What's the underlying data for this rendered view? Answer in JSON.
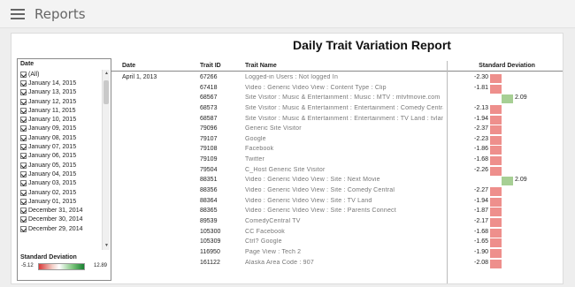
{
  "app": {
    "title": "Reports"
  },
  "report": {
    "title": "Daily Trait Variation Report",
    "filter": {
      "title": "Date",
      "items": [
        "(All)",
        "January 14, 2015",
        "January 13, 2015",
        "January 12, 2015",
        "January 11, 2015",
        "January 10, 2015",
        "January 09, 2015",
        "January 08, 2015",
        "January 07, 2015",
        "January 06, 2015",
        "January 05, 2015",
        "January 04, 2015",
        "January 03, 2015",
        "January 02, 2015",
        "January 01, 2015",
        "December 31, 2014",
        "December 30, 2014",
        "December 29, 2014"
      ]
    },
    "legend": {
      "title": "Standard Deviation",
      "min": "-5.12",
      "max": "12.89",
      "colors": {
        "negative": "#d93a3a",
        "neutral": "#ffffff",
        "positive": "#17802f"
      }
    },
    "columns": {
      "date": "Date",
      "trait_id": "Trait ID",
      "trait_name": "Trait Name",
      "standard_deviation": "Standard Deviation"
    },
    "rows": [
      {
        "date": "April 1, 2013",
        "trait_id": "67266",
        "trait_name": "Logged-in Users : Not logged In",
        "value": "-2.30",
        "sign": "negative"
      },
      {
        "date": "",
        "trait_id": "67418",
        "trait_name": "Video : Generic Video View : Content Type : Clip",
        "value": "-1.81",
        "sign": "negative"
      },
      {
        "date": "",
        "trait_id": "68567",
        "trait_name": "Site Visitor : Music & Entertainment : Music : MTV : mtvfmovie.com",
        "value": "2.09",
        "sign": "positive"
      },
      {
        "date": "",
        "trait_id": "68573",
        "trait_name": "Site Visitor : Music & Entertainment : Entertainment : Comedy Central : c...",
        "value": "-2.13",
        "sign": "negative"
      },
      {
        "date": "",
        "trait_id": "68587",
        "trait_name": "Site Visitor : Music & Entertainment : Entertainment : TV Land : tvland.com",
        "value": "-1.94",
        "sign": "negative"
      },
      {
        "date": "",
        "trait_id": "79096",
        "trait_name": "Generic Site Visitor",
        "value": "-2.37",
        "sign": "negative"
      },
      {
        "date": "",
        "trait_id": "79107",
        "trait_name": "Google",
        "value": "-2.23",
        "sign": "negative"
      },
      {
        "date": "",
        "trait_id": "79108",
        "trait_name": "Facebook",
        "value": "-1.86",
        "sign": "negative"
      },
      {
        "date": "",
        "trait_id": "79109",
        "trait_name": "Twitter",
        "value": "-1.68",
        "sign": "negative"
      },
      {
        "date": "",
        "trait_id": "79504",
        "trait_name": "C_Host Generic Site Visitor",
        "value": "-2.26",
        "sign": "negative"
      },
      {
        "date": "",
        "trait_id": "88351",
        "trait_name": "Video : Generic Video View : Site : Next Movie",
        "value": "2.09",
        "sign": "positive"
      },
      {
        "date": "",
        "trait_id": "88356",
        "trait_name": "Video : Generic Video View : Site : Comedy Central",
        "value": "-2.27",
        "sign": "negative"
      },
      {
        "date": "",
        "trait_id": "88364",
        "trait_name": "Video : Generic Video View : Site : TV Land",
        "value": "-1.94",
        "sign": "negative"
      },
      {
        "date": "",
        "trait_id": "88365",
        "trait_name": "Video : Generic Video View : Site : Parents Connect",
        "value": "-1.87",
        "sign": "negative"
      },
      {
        "date": "",
        "trait_id": "89539",
        "trait_name": "ComedyCentral TV",
        "value": "-2.17",
        "sign": "negative"
      },
      {
        "date": "",
        "trait_id": "105300",
        "trait_name": "CC Facebook",
        "value": "-1.68",
        "sign": "negative"
      },
      {
        "date": "",
        "trait_id": "105309",
        "trait_name": "Ctrl? Google",
        "value": "-1.65",
        "sign": "negative"
      },
      {
        "date": "",
        "trait_id": "116950",
        "trait_name": "Page View : Tech 2",
        "value": "-1.90",
        "sign": "negative"
      },
      {
        "date": "",
        "trait_id": "161122",
        "trait_name": "Alaska Area Code : 907",
        "value": "-2.08",
        "sign": "negative"
      }
    ]
  }
}
